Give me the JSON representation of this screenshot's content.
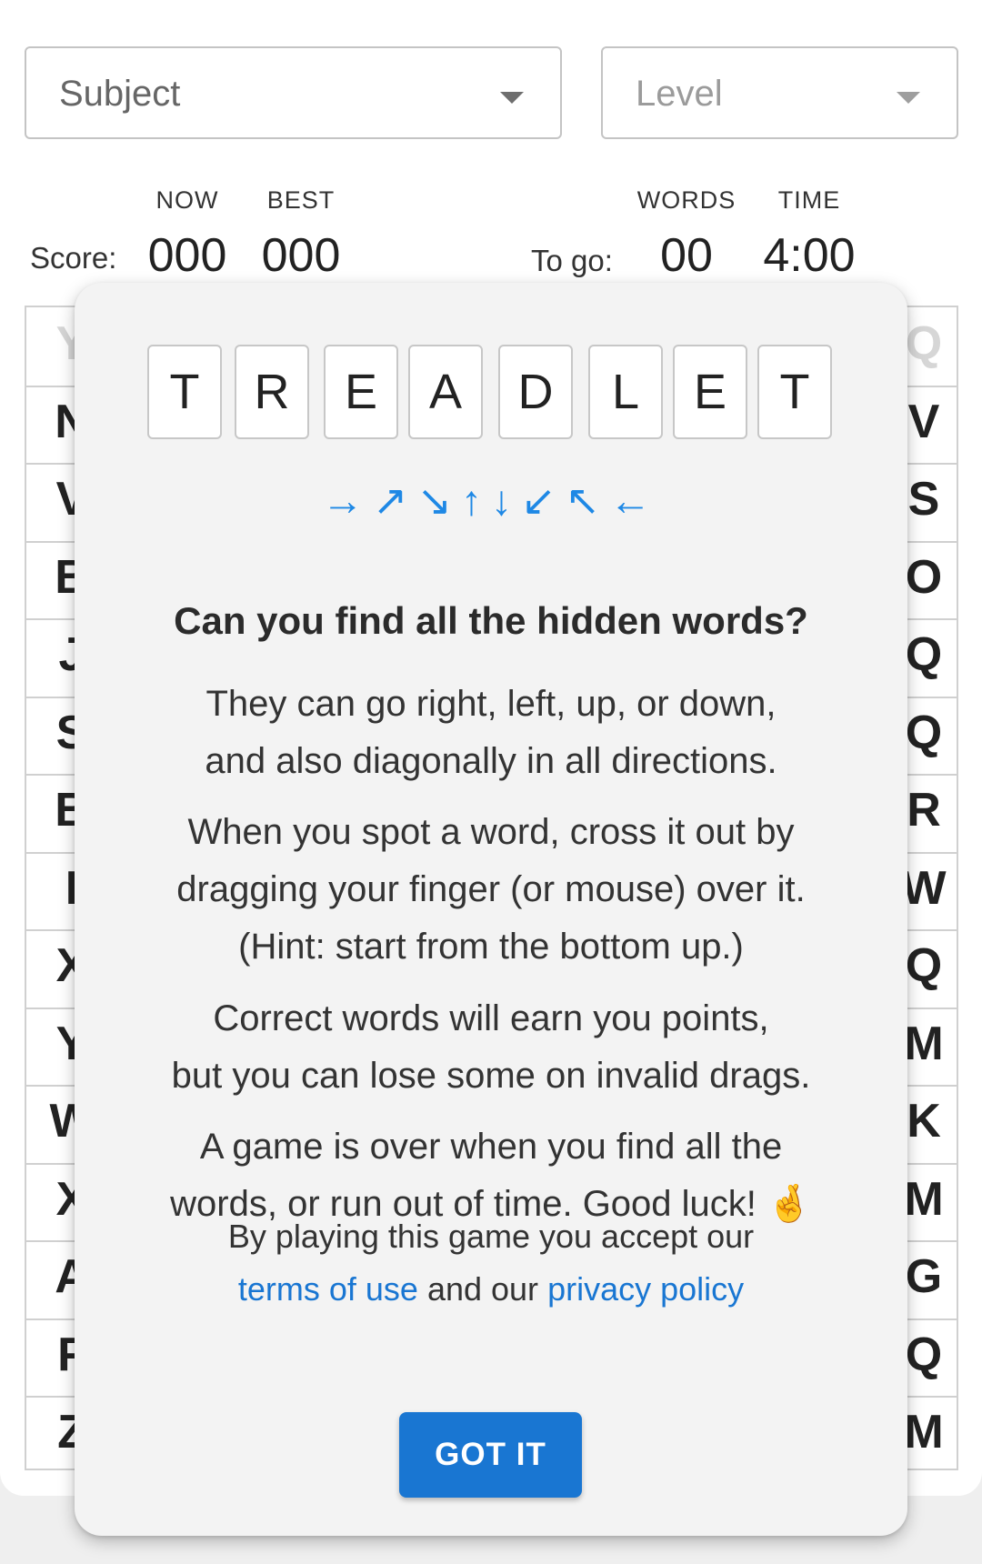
{
  "filters": {
    "subject_label": "Subject",
    "level_label": "Level"
  },
  "score": {
    "label": "Score:",
    "now_header": "NOW",
    "best_header": "BEST",
    "now_value": "000",
    "best_value": "000"
  },
  "togo": {
    "label": "To go:",
    "words_header": "WORDS",
    "time_header": "TIME",
    "words_value": "00",
    "time_value": "4:00"
  },
  "grid": {
    "left_column": [
      "Y",
      "N",
      "V",
      "B",
      "J",
      "S",
      "B",
      "I",
      "X",
      "Y",
      "W",
      "X",
      "A",
      "F",
      "Z"
    ],
    "right_column": [
      "Q",
      "V",
      "S",
      "O",
      "Q",
      "Q",
      "R",
      "W",
      "Q",
      "M",
      "K",
      "M",
      "G",
      "Q",
      "M"
    ]
  },
  "dialog": {
    "logo_letters": [
      "T",
      "R",
      "E",
      "A",
      "D",
      "L",
      "E",
      "T"
    ],
    "arrows": [
      "→",
      "↗",
      "↘",
      "↑",
      "↓",
      "↙",
      "↖",
      "←"
    ],
    "heading": "Can you find all the hidden words?",
    "p1": [
      "They can go right, left, up, or down,",
      "and also diagonally in all directions."
    ],
    "p2": [
      "When you spot a word, cross it out by",
      "dragging your finger (or mouse) over it.",
      "(Hint: start from the bottom up.)"
    ],
    "p3": [
      "Correct words will earn you points,",
      "but you can lose some on invalid drags."
    ],
    "p4": [
      "A game is over when you find all the",
      "words, or run out of time. Good luck! 🤞"
    ],
    "consent_text": "By playing this game you accept our",
    "terms_link": "terms of use",
    "and_our": "and our",
    "privacy_link": "privacy policy",
    "button_label": "GOT IT"
  }
}
